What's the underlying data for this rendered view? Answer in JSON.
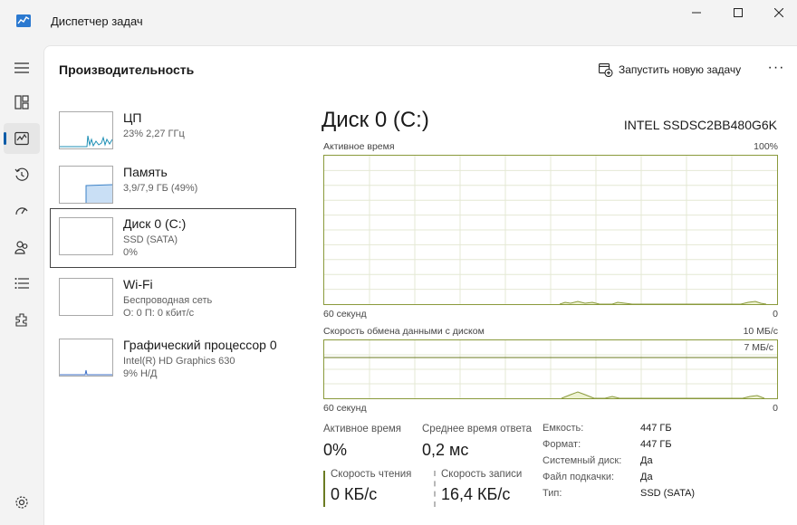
{
  "window": {
    "title": "Диспетчер задач"
  },
  "header": {
    "section_title": "Производительность",
    "new_task_label": "Запустить новую задачу",
    "more_label": "···"
  },
  "devices": [
    {
      "name": "ЦП",
      "line1": "23% 2,27 ГГц",
      "line2": ""
    },
    {
      "name": "Память",
      "line1": "3,9/7,9 ГБ (49%)",
      "line2": ""
    },
    {
      "name": "Диск 0 (C:)",
      "line1": "SSD (SATA)",
      "line2": "0%"
    },
    {
      "name": "Wi-Fi",
      "line1": "Беспроводная сеть",
      "line2": "О: 0 П: 0 кбит/с"
    },
    {
      "name": "Графический процессор 0",
      "line1": "Intel(R) HD Graphics 630",
      "line2": "9% Н/Д"
    }
  ],
  "detail": {
    "title": "Диск 0 (C:)",
    "model": "INTEL SSDSC2BB480G6K",
    "graph1": {
      "label": "Активное время",
      "max_label": "100%",
      "time_label": "60 секунд",
      "min_label": "0"
    },
    "graph2": {
      "label": "Скорость обмена данными с диском",
      "max_label": "10 МБ/с",
      "line_label": "7 МБ/с",
      "time_label": "60 секунд",
      "min_label": "0"
    },
    "stats": {
      "active_time_label": "Активное время",
      "active_time_value": "0%",
      "response_label": "Среднее время ответа",
      "response_value": "0,2 мс",
      "read_label": "Скорость чтения",
      "read_value": "0 КБ/с",
      "write_label": "Скорость записи",
      "write_value": "16,4 КБ/с"
    },
    "properties": [
      {
        "key": "Емкость:",
        "value": "447 ГБ"
      },
      {
        "key": "Формат:",
        "value": "447 ГБ"
      },
      {
        "key": "Системный диск:",
        "value": "Да"
      },
      {
        "key": "Файл подкачки:",
        "value": "Да"
      },
      {
        "key": "Тип:",
        "value": "SSD (SATA)"
      }
    ]
  },
  "colors": {
    "accent": "#0b5ca8",
    "disk_graph": "#8a9a3c",
    "disk_fill": "#eef3d2",
    "cpu_line": "#1d8fb5",
    "mem_fill": "#c9dff5",
    "mem_line": "#3c82c7",
    "read_bar": "#6b7b22",
    "write_bar": "#c8c8c8"
  },
  "icons": {
    "app": "taskmanager-icon",
    "menu": "hamburger-icon",
    "processes": "processes-icon",
    "performance": "performance-icon",
    "history": "history-icon",
    "startup": "startup-icon",
    "users": "users-icon",
    "details": "details-icon",
    "services": "services-icon",
    "settings": "gear-icon"
  }
}
